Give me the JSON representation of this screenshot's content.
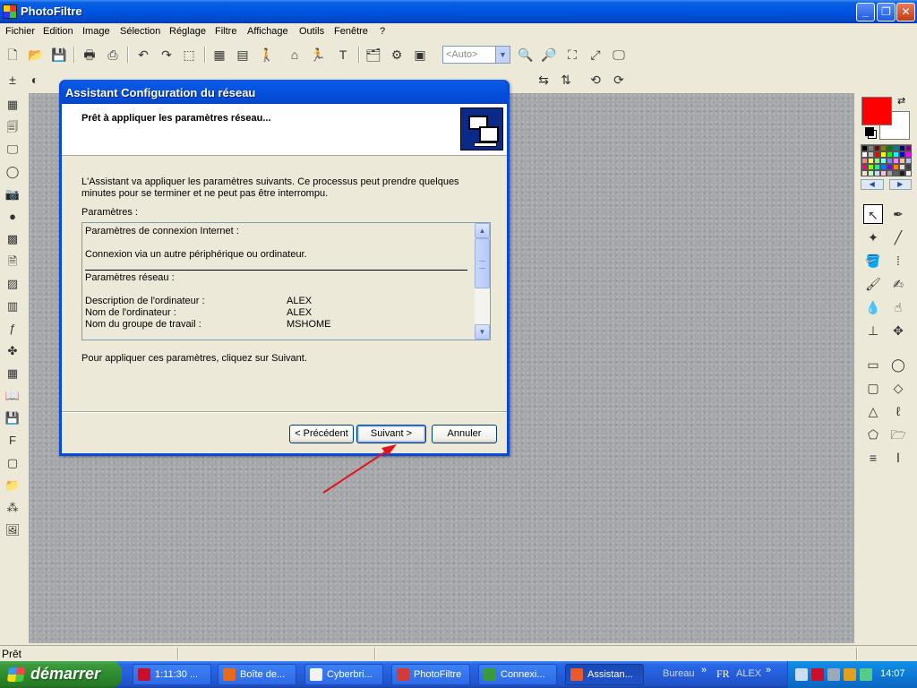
{
  "app": {
    "title": "PhotoFiltre"
  },
  "menu": [
    "Fichier",
    "Edition",
    "Image",
    "Sélection",
    "Réglage",
    "Filtre",
    "Affichage",
    "Outils",
    "Fenêtre",
    "?"
  ],
  "toolbar": {
    "zoom_placeholder": "<Auto>"
  },
  "dialog": {
    "title": "Assistant Configuration du réseau",
    "heading": "Prêt à appliquer les paramètres réseau...",
    "intro": "L'Assistant va appliquer les paramètres suivants. Ce processus peut prendre quelques minutes pour se terminer et ne peut pas être interrompu.",
    "params_label": "Paramètres :",
    "params": {
      "internet_heading": "Paramètres de connexion Internet :",
      "connection": "Connexion via un autre périphérique ou ordinateur.",
      "network_heading": "Paramètres réseau :",
      "rows": [
        {
          "label": "Description de l'ordinateur :",
          "value": "ALEX"
        },
        {
          "label": "Nom de l'ordinateur :",
          "value": "ALEX"
        },
        {
          "label": "Nom du groupe de travail :",
          "value": "MSHOME"
        }
      ]
    },
    "apply_text": "Pour appliquer ces paramètres, cliquez sur Suivant.",
    "buttons": {
      "back": "< Précédent",
      "next": "Suivant >",
      "cancel": "Annuler"
    }
  },
  "status": {
    "text": "Prêt"
  },
  "taskbar": {
    "start": "démarrer",
    "items": [
      {
        "label": "1:11:30 ...",
        "color": "#c8102e"
      },
      {
        "label": "Boîte de...",
        "color": "#e86a1a"
      },
      {
        "label": "Cyberbri...",
        "color": "#f2f2f2"
      },
      {
        "label": "PhotoFiltre",
        "color": "#d43a3a"
      },
      {
        "label": "Connexi...",
        "color": "#3a9a3a"
      },
      {
        "label": "Assistan...",
        "color": "#e85a2a"
      }
    ],
    "quicklaunch": "Bureau",
    "language": "FR",
    "user": "ALEX",
    "clock": "14:07"
  },
  "colors": {
    "foreground": "#ff0000",
    "background": "#ffffff",
    "accent": "#0a4ad8"
  }
}
